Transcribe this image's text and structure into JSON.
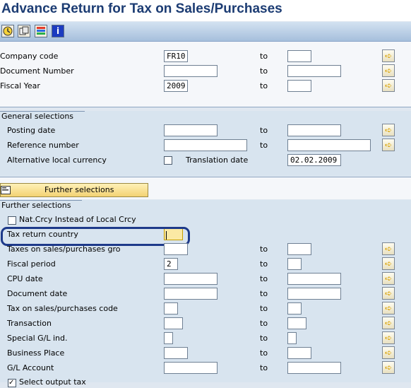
{
  "title": "Advance Return for Tax on Sales/Purchases",
  "toolbar_icons": [
    "execute-icon",
    "get-variant-icon",
    "dynamic-selections-icon",
    "info-icon"
  ],
  "to_label": "to",
  "top": {
    "company_code_label": "Company code",
    "company_code_value": "FR10",
    "document_number_label": "Document Number",
    "fiscal_year_label": "Fiscal Year",
    "fiscal_year_value": "2009"
  },
  "general": {
    "header": "General selections",
    "posting_date_label": "Posting date",
    "reference_number_label": "Reference number",
    "alt_currency_label": "Alternative local currency",
    "translation_date_label": "Translation date",
    "translation_date_value": "02.02.2009"
  },
  "further": {
    "button_label": "Further selections",
    "header": "Further selections",
    "nat_crcy_label": "Nat.Crcy Instead of Local Crcy",
    "tax_return_country_label": "Tax return country",
    "taxes_gross_label": "Taxes on sales/purchases gro",
    "fiscal_period_label": "Fiscal period",
    "fiscal_period_value": "2",
    "cpu_date_label": "CPU date",
    "document_date_label": "Document date",
    "tax_code_label": "Tax on sales/purchases code",
    "transaction_label": "Transaction",
    "special_gl_label": "Special G/L ind.",
    "business_place_label": "Business Place",
    "gl_account_label": "G/L Account",
    "select_output_tax_label": "Select output tax"
  },
  "colors": {
    "title": "#1c3c73",
    "focus_field": "#fbe9a4",
    "highlight_border": "#1e3a8a"
  }
}
